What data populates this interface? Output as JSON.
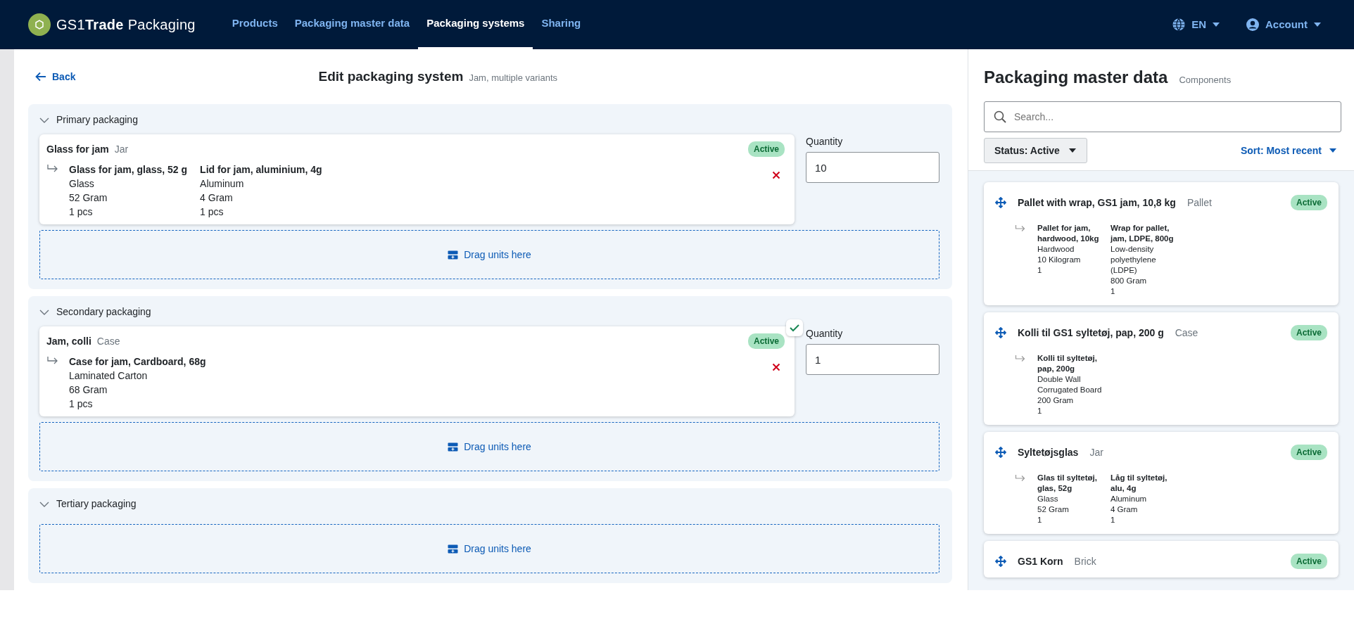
{
  "navbar": {
    "logo": "GS1**Trade** Packaging",
    "items": [
      {
        "label": "Products",
        "selected": false
      },
      {
        "label": "Packaging master data",
        "selected": false
      },
      {
        "label": "Packaging systems",
        "selected": true
      },
      {
        "label": "Sharing",
        "selected": false
      }
    ],
    "language": "EN",
    "account": "Account"
  },
  "editor": {
    "back": "Back",
    "title": "Edit packaging system",
    "subtitle": "Jam, multiple variants",
    "sections": [
      {
        "title": "Primary packaging",
        "expanded": true,
        "quantity_label": "Quantity",
        "quantity": "10",
        "drop_label": "Drag units here",
        "units": [
          {
            "name": "Glass for jam",
            "type": "Jar",
            "status": "Active",
            "valid": false,
            "components": [
              {
                "name": "Glass for jam, glass, 52 g",
                "material": "Glass",
                "weight": "52 Gram",
                "count": "1 pcs"
              },
              {
                "name": "Lid for jam, aluminium, 4g",
                "material": "Aluminum",
                "weight": "4 Gram",
                "count": "1 pcs"
              }
            ]
          }
        ]
      },
      {
        "title": "Secondary packaging",
        "expanded": true,
        "quantity_label": "Quantity",
        "quantity": "1",
        "drop_label": "Drag units here",
        "units": [
          {
            "name": "Jam, colli",
            "type": "Case",
            "status": "Active",
            "valid": true,
            "components": [
              {
                "name": "Case for jam, Cardboard, 68g",
                "material": "Laminated Carton",
                "weight": "68 Gram",
                "count": "1 pcs"
              }
            ]
          }
        ]
      },
      {
        "title": "Tertiary packaging",
        "expanded": true,
        "drop_label": "Drag units here"
      }
    ]
  },
  "master_data": {
    "title": "Packaging master data",
    "subtitle": "Components",
    "search": {
      "placeholder": "Search..."
    },
    "status_filter": "Status: Active",
    "sort": "Sort: Most recent",
    "items": [
      {
        "name": "Pallet with wrap, GS1 jam, 10,8 kg",
        "type": "Pallet",
        "status": "Active",
        "components": [
          {
            "name": "Pallet for jam, hardwood, 10kg",
            "material": "Hardwood",
            "weight": "10 Kilogram",
            "count": "1"
          },
          {
            "name": "Wrap for pallet, jam, LDPE, 800g",
            "material": "Low-density polyethylene (LDPE)",
            "weight": "800 Gram",
            "count": "1"
          }
        ]
      },
      {
        "name": "Kolli til GS1 syltetøj, pap, 200 g",
        "type": "Case",
        "status": "Active",
        "components": [
          {
            "name": "Kolli til syltetøj, pap, 200g",
            "material": "Double Wall Corrugated Board",
            "weight": "200 Gram",
            "count": "1"
          }
        ]
      },
      {
        "name": "Syltetøjsglas",
        "type": "Jar",
        "status": "Active",
        "components": [
          {
            "name": "Glas til syltetøj, glas, 52g",
            "material": "Glass",
            "weight": "52 Gram",
            "count": "1"
          },
          {
            "name": "Låg til syltetøj, alu, 4g",
            "material": "Aluminum",
            "weight": "4 Gram",
            "count": "1"
          }
        ]
      },
      {
        "name": "GS1 Korn",
        "type": "Brick",
        "status": "Active"
      }
    ]
  }
}
